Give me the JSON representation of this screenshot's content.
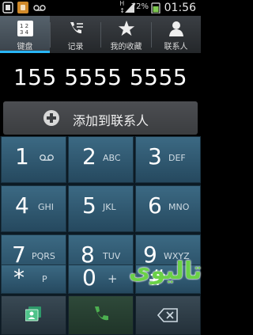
{
  "status_bar": {
    "network": "H",
    "battery_percent": "72%",
    "time": "01:56"
  },
  "tabs": [
    {
      "label": "键盘",
      "icon": "dialpad-icon",
      "selected": true
    },
    {
      "label": "记录",
      "icon": "call-log-icon",
      "selected": false
    },
    {
      "label": "我的收藏",
      "icon": "star-icon",
      "selected": false
    },
    {
      "label": "联系人",
      "icon": "person-icon",
      "selected": false
    }
  ],
  "dialed_number": "155 5555 5555",
  "add_contact_label": "添加到联系人",
  "keys": [
    {
      "digit": "1",
      "letters": ""
    },
    {
      "digit": "2",
      "letters": "ABC"
    },
    {
      "digit": "3",
      "letters": "DEF"
    },
    {
      "digit": "4",
      "letters": "GHI"
    },
    {
      "digit": "5",
      "letters": "JKL"
    },
    {
      "digit": "6",
      "letters": "MNO"
    },
    {
      "digit": "7",
      "letters": "PQRS"
    },
    {
      "digit": "8",
      "letters": "TUV"
    },
    {
      "digit": "9",
      "letters": "WXYZ"
    },
    {
      "digit": "*",
      "letters": "P"
    },
    {
      "digit": "0",
      "letters": "+"
    },
    {
      "digit": "#",
      "letters": ""
    }
  ],
  "bottom_buttons": [
    "contacts-card-icon",
    "phone-call-icon",
    "backspace-icon"
  ],
  "watermark": "تالیوی",
  "colors": {
    "accent": "#29b6f6",
    "key_bg": "#2e5a73",
    "call_green": "#4caf50"
  }
}
